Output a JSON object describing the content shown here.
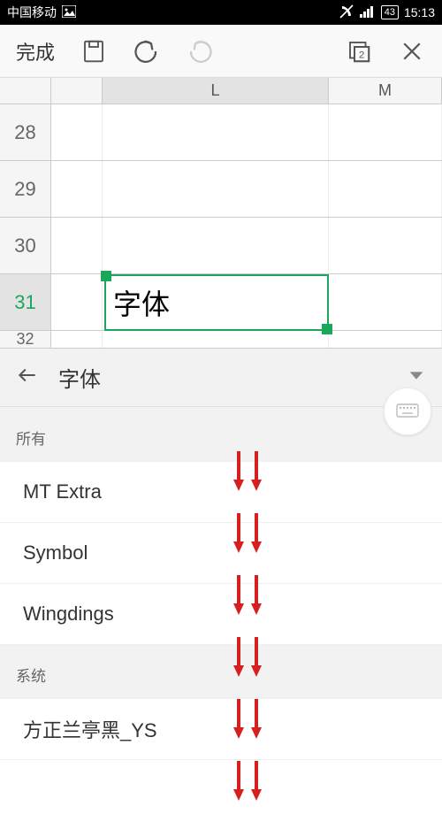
{
  "status": {
    "carrier": "中国移动",
    "battery": "43",
    "time": "15:13"
  },
  "toolbar": {
    "done": "完成"
  },
  "columns": {
    "L": "L",
    "M": "M"
  },
  "rows": [
    "28",
    "29",
    "30",
    "31",
    "32"
  ],
  "selected_cell_value": "字体",
  "panel": {
    "title": "字体",
    "section_all": "所有",
    "section_system": "系统",
    "fonts_all": [
      "MT Extra",
      "Symbol",
      "Wingdings"
    ],
    "fonts_system": [
      "方正兰亭黑_YS"
    ]
  }
}
